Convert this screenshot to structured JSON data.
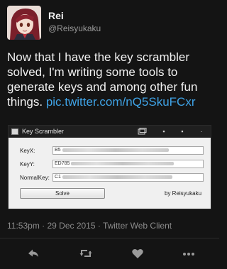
{
  "user": {
    "display_name": "Rei",
    "handle": "@Reisyukaku"
  },
  "tweet": {
    "text": "Now that I have the key scrambler solved, I'm writing some tools to generate keys and among other fun things. ",
    "link": "pic.twitter.com/nQ5SkuFCxr"
  },
  "media": {
    "window_title": "Key Scrambler",
    "fields": [
      {
        "label": "KeyX:",
        "value_prefix": "B5"
      },
      {
        "label": "KeyY:",
        "value_prefix": "ED785"
      },
      {
        "label": "NormalKey:",
        "value_prefix": "C1"
      }
    ],
    "solve_label": "Solve",
    "credit": "by Reisyukaku"
  },
  "meta": {
    "timestamp": "11:53pm · 29 Dec 2015 · Twitter Web Client"
  },
  "actions": {
    "icons": [
      "reply-icon",
      "retweet-icon",
      "like-icon",
      "more-icon"
    ]
  },
  "colors": {
    "background": "#141414",
    "link": "#3fa3e6",
    "muted": "#8c8c8c"
  }
}
